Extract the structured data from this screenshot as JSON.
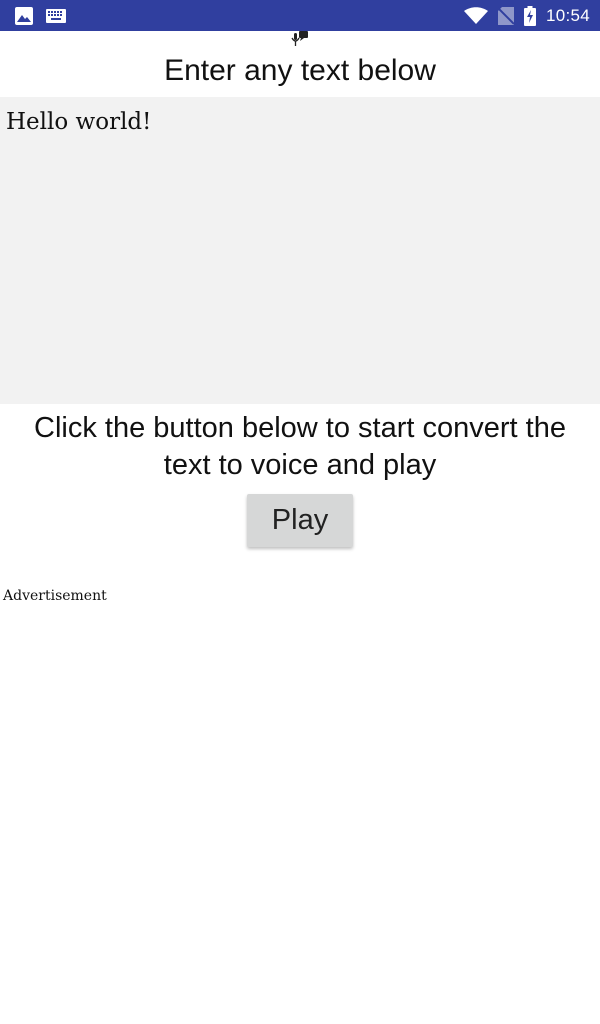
{
  "status_bar": {
    "time": "10:54",
    "icons": [
      "image-icon",
      "keyboard-icon",
      "wifi-icon",
      "no-sim-icon",
      "battery-charging-icon"
    ],
    "background": "#303f9f"
  },
  "app": {
    "heading": "Enter any text below",
    "input": {
      "value": "Hello world!"
    },
    "instruction": "Click the button below to start convert the text to voice and play",
    "play_label": "Play",
    "ad_label": "Advertisement"
  },
  "colors": {
    "input_background": "#f2f2f2",
    "button_background": "#d6d7d7"
  }
}
